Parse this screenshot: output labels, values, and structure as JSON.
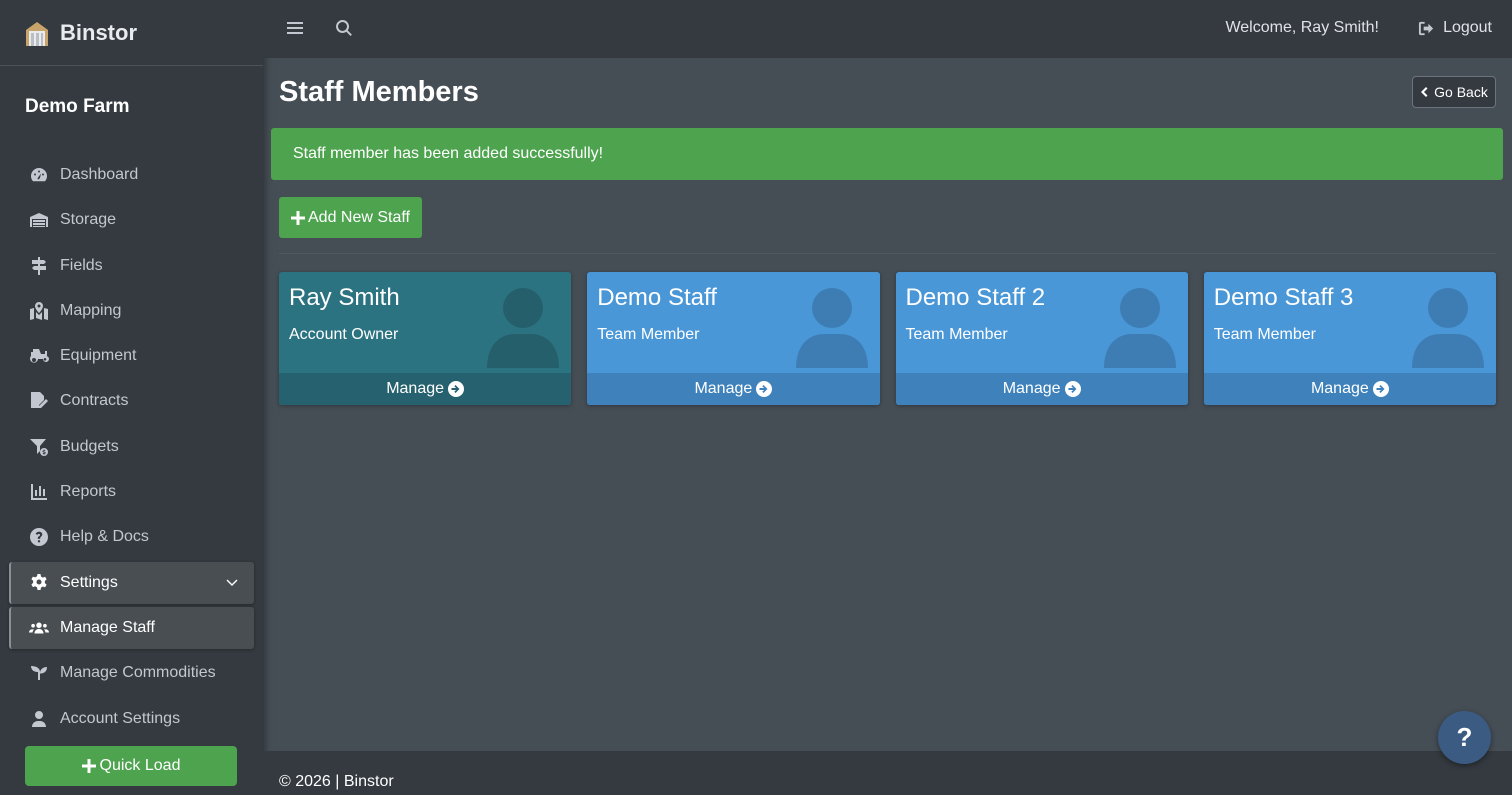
{
  "brand": {
    "name": "Binstor",
    "logo_icon": "barn-silo-icon"
  },
  "sidebar": {
    "farm_name": "Demo Farm",
    "items": [
      {
        "label": "Dashboard",
        "icon": "tachometer-icon"
      },
      {
        "label": "Storage",
        "icon": "warehouse-icon"
      },
      {
        "label": "Fields",
        "icon": "signpost-icon"
      },
      {
        "label": "Mapping",
        "icon": "map-marked-icon"
      },
      {
        "label": "Equipment",
        "icon": "tractor-icon"
      },
      {
        "label": "Contracts",
        "icon": "file-signature-icon"
      },
      {
        "label": "Budgets",
        "icon": "funnel-dollar-icon"
      },
      {
        "label": "Reports",
        "icon": "chart-bar-icon"
      },
      {
        "label": "Help & Docs",
        "icon": "question-circle-icon"
      },
      {
        "label": "Settings",
        "icon": "gear-icon"
      },
      {
        "label": "Manage Staff",
        "icon": "users-icon"
      },
      {
        "label": "Manage Commodities",
        "icon": "seedling-icon"
      },
      {
        "label": "Account Settings",
        "icon": "user-icon"
      }
    ],
    "active": [
      "Settings",
      "Manage Staff"
    ],
    "quick_load_label": "Quick Load"
  },
  "header": {
    "welcome": "Welcome, Ray Smith!",
    "logout_label": "Logout"
  },
  "main": {
    "title": "Staff Members",
    "go_back_label": "Go Back",
    "alert": "Staff member has been added successfully!",
    "add_staff_label": "Add New Staff",
    "staff": [
      {
        "name": "Ray Smith",
        "role": "Account Owner",
        "manage_label": "Manage"
      },
      {
        "name": "Demo Staff",
        "role": "Team Member",
        "manage_label": "Manage"
      },
      {
        "name": "Demo Staff 2",
        "role": "Team Member",
        "manage_label": "Manage"
      },
      {
        "name": "Demo Staff 3",
        "role": "Team Member",
        "manage_label": "Manage"
      }
    ]
  },
  "footer": {
    "text": "© 2026 | Binstor"
  },
  "help_fab": {
    "label": "?"
  },
  "colors": {
    "success": "#4ea34f",
    "owner_card": "#2c7382",
    "member_card": "#4a97d8",
    "sidebar": "#343a40",
    "content": "#454d55"
  }
}
